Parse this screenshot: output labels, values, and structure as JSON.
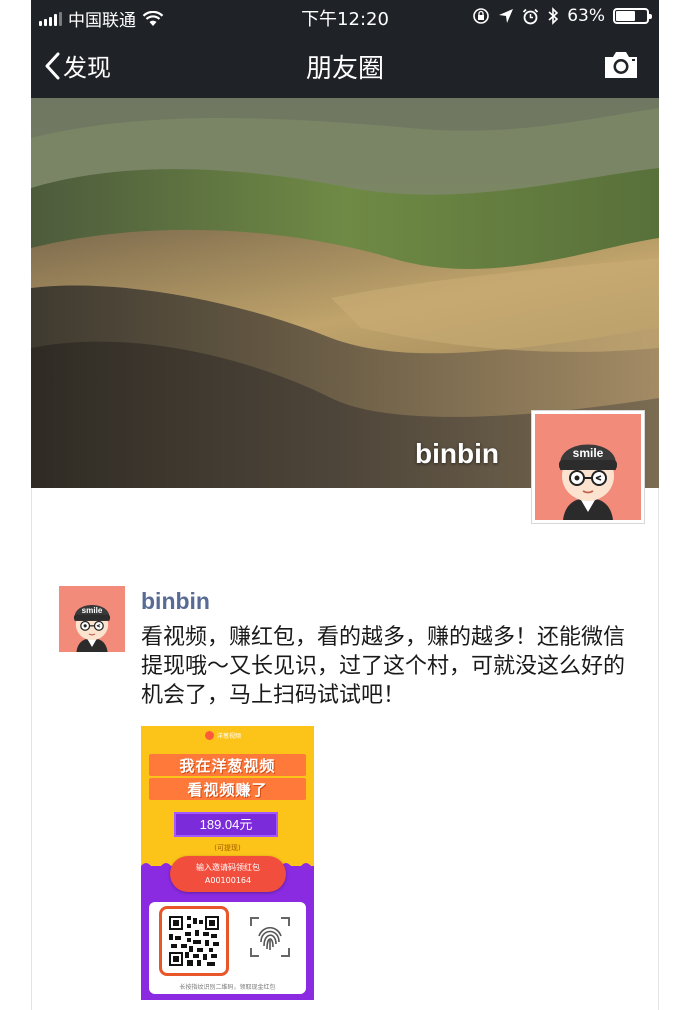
{
  "status_bar": {
    "carrier": "中国联通",
    "time": "下午12:20",
    "battery_percent": "63%",
    "battery_level": 0.63
  },
  "nav": {
    "back_label": "发现",
    "title": "朋友圈"
  },
  "cover": {
    "username": "binbin",
    "avatar_text": "smile"
  },
  "post": {
    "author": "binbin",
    "avatar_text": "smile",
    "text": "看视频，赚红包，看的越多，赚的越多！还能微信提现哦～又长见识，过了这个村，可就没这么好的机会了，马上扫码试试吧！",
    "image": {
      "app_name": "洋葱视频",
      "title_line1": "我在洋葱视频",
      "title_line2": "看视频赚了",
      "amount": "189.04元",
      "withdraw_note": "(可提现)",
      "invite_label": "输入邀请码领红包",
      "invite_code": "A00100164",
      "hint": "长按指纹识别二维码，领取现金红包"
    }
  },
  "colors": {
    "bar_bg": "#1f2227",
    "link": "#576b95",
    "avatar_bg": "#f38b7a",
    "poster_yellow": "#fcc419",
    "poster_purple": "#8a2be2"
  }
}
